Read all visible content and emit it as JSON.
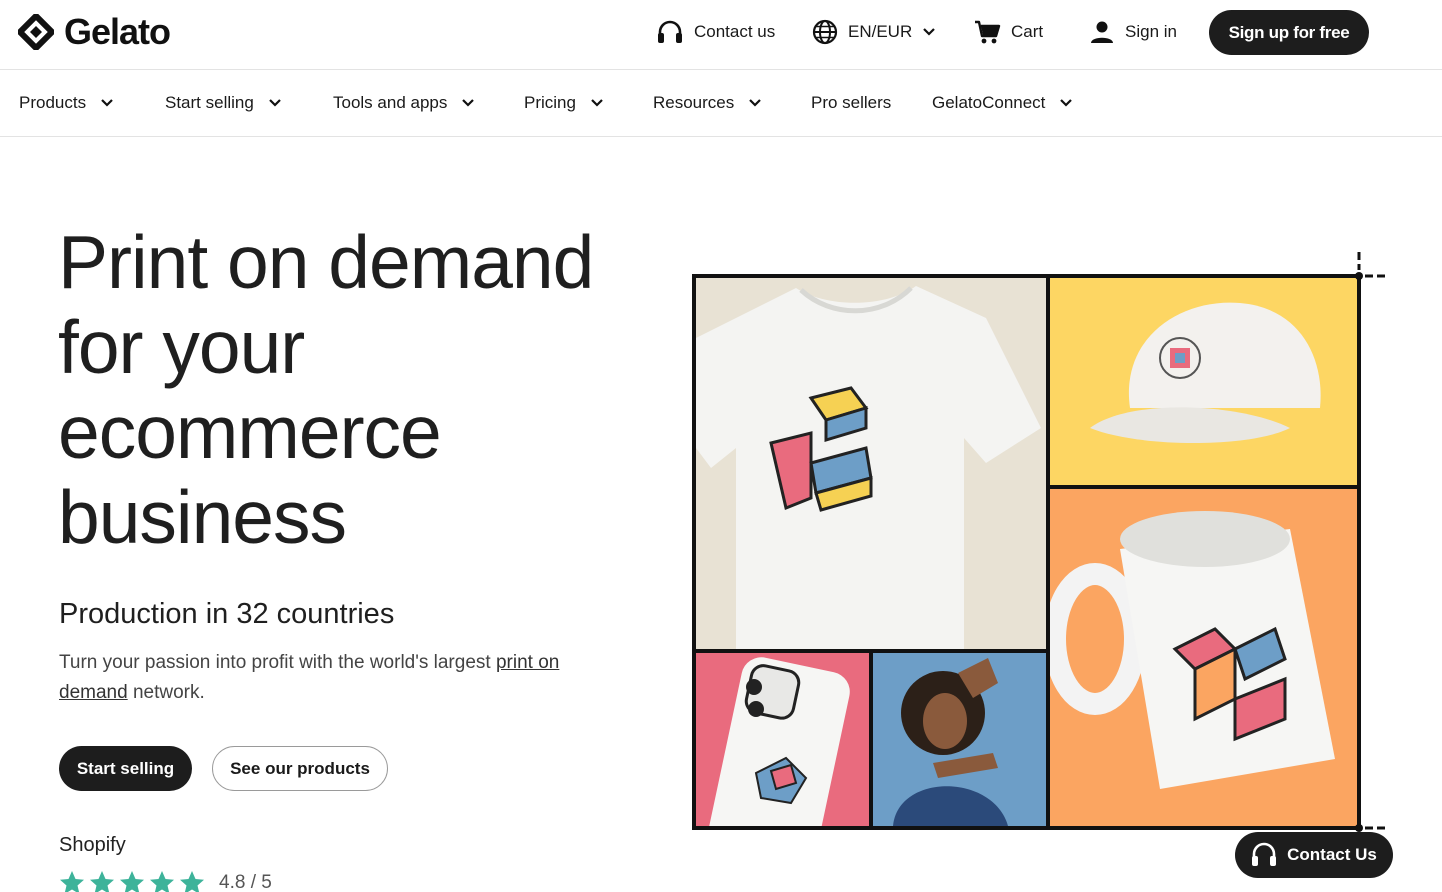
{
  "brand": {
    "name": "Gelato"
  },
  "header": {
    "contact_label": "Contact us",
    "locale_label": "EN/EUR",
    "cart_label": "Cart",
    "signin_label": "Sign in",
    "signup_label": "Sign up for free"
  },
  "nav": {
    "items": [
      {
        "label": "Products"
      },
      {
        "label": "Start selling"
      },
      {
        "label": "Tools and apps"
      },
      {
        "label": "Pricing"
      },
      {
        "label": "Resources"
      },
      {
        "label": "Pro sellers"
      },
      {
        "label": "GelatoConnect"
      }
    ]
  },
  "hero": {
    "title_lines": [
      "Print on demand",
      "for your",
      "ecommerce",
      "business"
    ],
    "subheading": "Production in 32 countries",
    "desc_before": "Turn your passion into profit with the world's largest ",
    "desc_link": "print on demand",
    "desc_after": " network.",
    "primary_cta": "Start selling",
    "secondary_cta": "See our products",
    "rating_source": "Shopify",
    "rating_value": "4.8 / 5",
    "rating_stars": 5
  },
  "floating": {
    "contact_label": "Contact Us"
  },
  "colors": {
    "dark": "#1d1d1d",
    "star": "#3db39a",
    "tile_beige": "#e8e2d4",
    "tile_yellow": "#fdd663",
    "tile_orange": "#fba561",
    "tile_pink": "#e96b7e",
    "tile_blue": "#6d9ec7"
  }
}
